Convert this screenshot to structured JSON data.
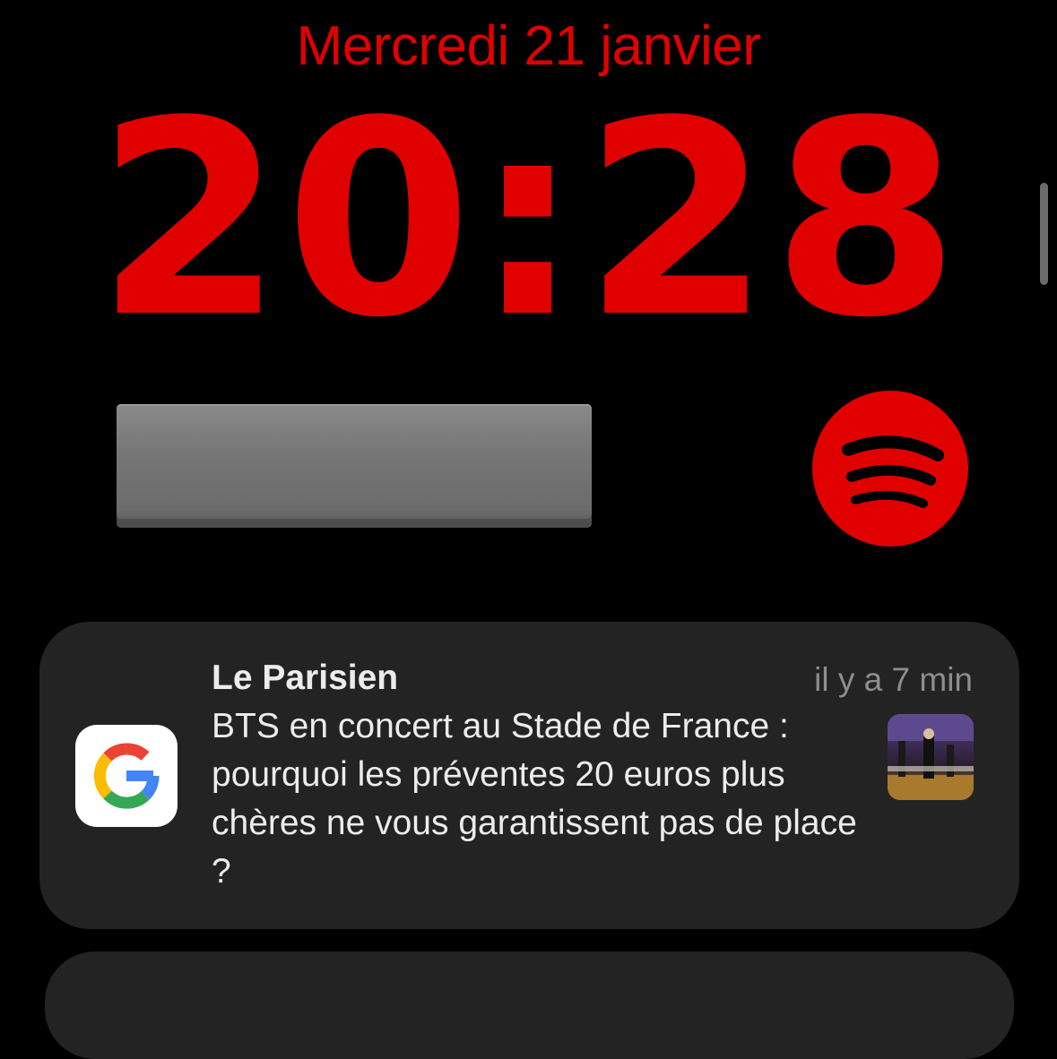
{
  "lock_screen": {
    "date": "Mercredi 21 janvier",
    "time": "20:28"
  },
  "widgets": {
    "spotify_icon": "spotify-icon",
    "accent_color": "#e00000"
  },
  "notification": {
    "app_icon": "google-icon",
    "source": "Le Parisien",
    "timestamp": "il y a 7 min",
    "body": "BTS en concert au Stade de France : pourquoi les préventes 20 euros plus chères ne vous garantissent pas de place ?"
  }
}
